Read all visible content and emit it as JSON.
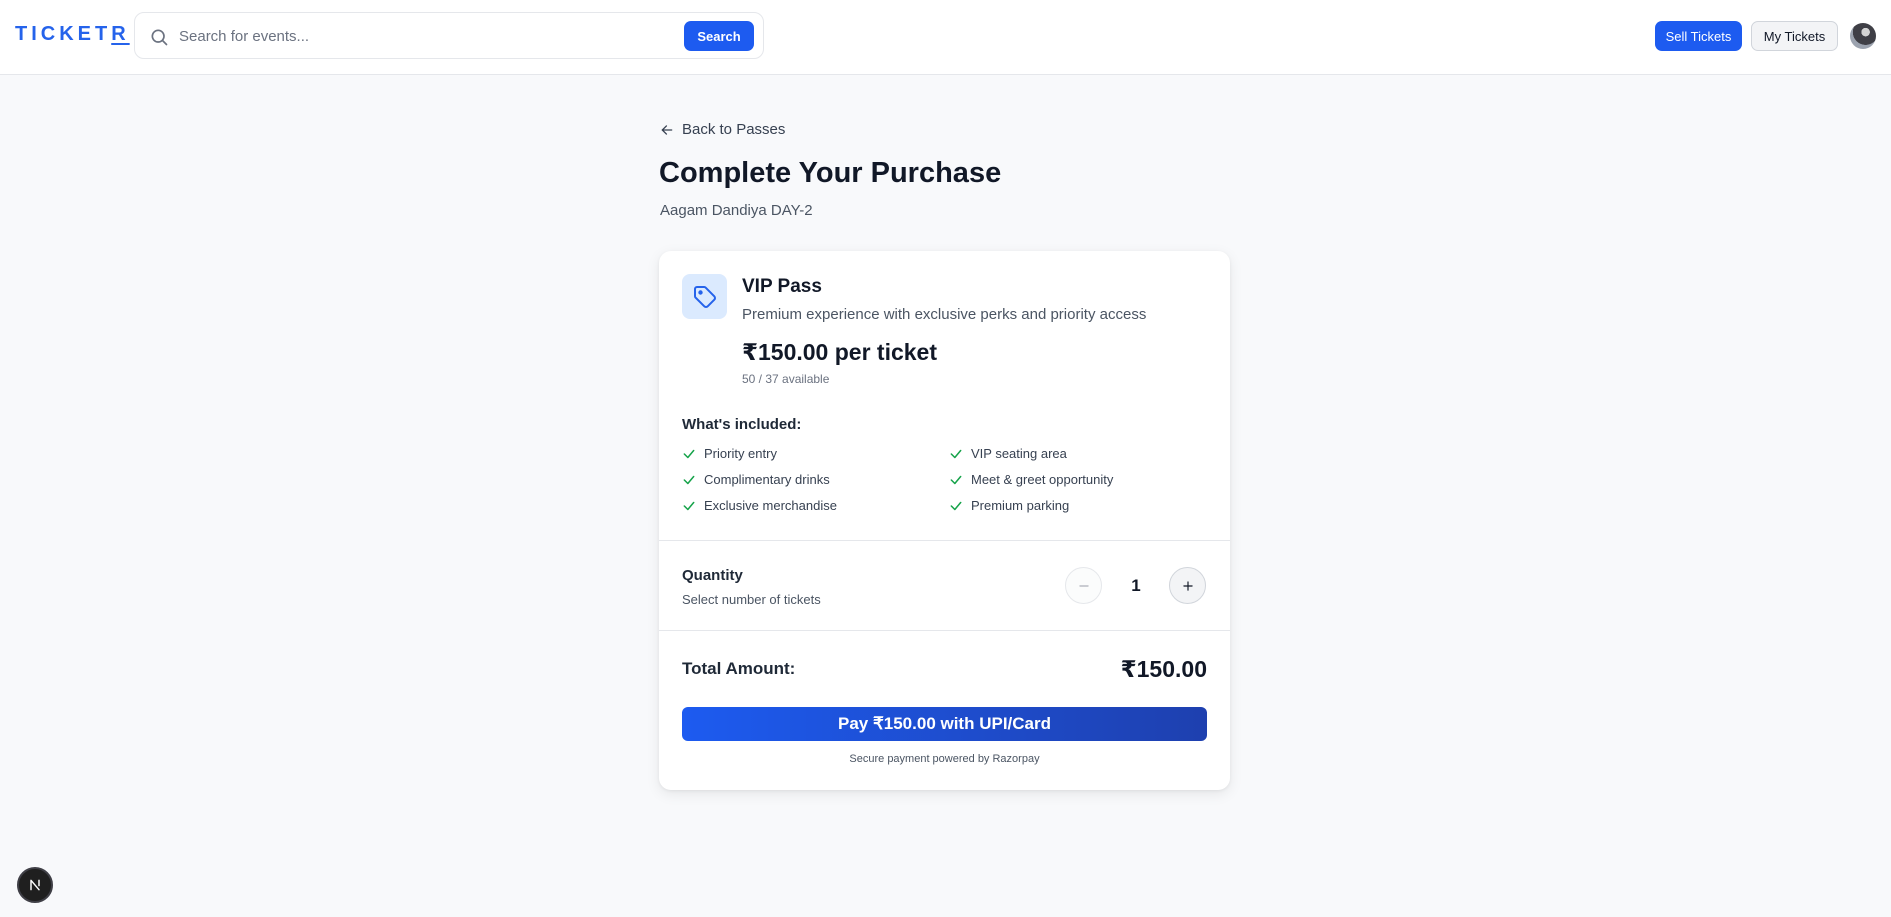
{
  "header": {
    "logo": "TICKETR",
    "search_placeholder": "Search for events...",
    "search_button": "Search",
    "sell_tickets": "Sell Tickets",
    "my_tickets": "My Tickets"
  },
  "page": {
    "back_label": "Back to Passes",
    "title": "Complete Your Purchase",
    "event_name": "Aagam Dandiya DAY-2"
  },
  "pass": {
    "name": "VIP Pass",
    "description": "Premium experience with exclusive perks and priority access",
    "price": "₹150.00 per ticket",
    "availability": "50 / 37 available",
    "included_heading": "What's included:",
    "perks": [
      "Priority entry",
      "VIP seating area",
      "Complimentary drinks",
      "Meet & greet opportunity",
      "Exclusive merchandise",
      "Premium parking"
    ]
  },
  "quantity": {
    "label": "Quantity",
    "sub_label": "Select number of tickets",
    "value": "1"
  },
  "total": {
    "label": "Total Amount:",
    "value": "₹150.00"
  },
  "payment": {
    "button": "Pay ₹150.00 with UPI/Card",
    "note": "Secure payment powered by Razorpay"
  },
  "colors": {
    "primary": "#1d5bf0",
    "check": "#16a34a",
    "background": "#f8f9fb"
  },
  "icons": [
    "search-icon",
    "arrow-left-icon",
    "tag-icon",
    "check-icon",
    "minus-icon",
    "plus-icon",
    "nextjs-icon"
  ]
}
